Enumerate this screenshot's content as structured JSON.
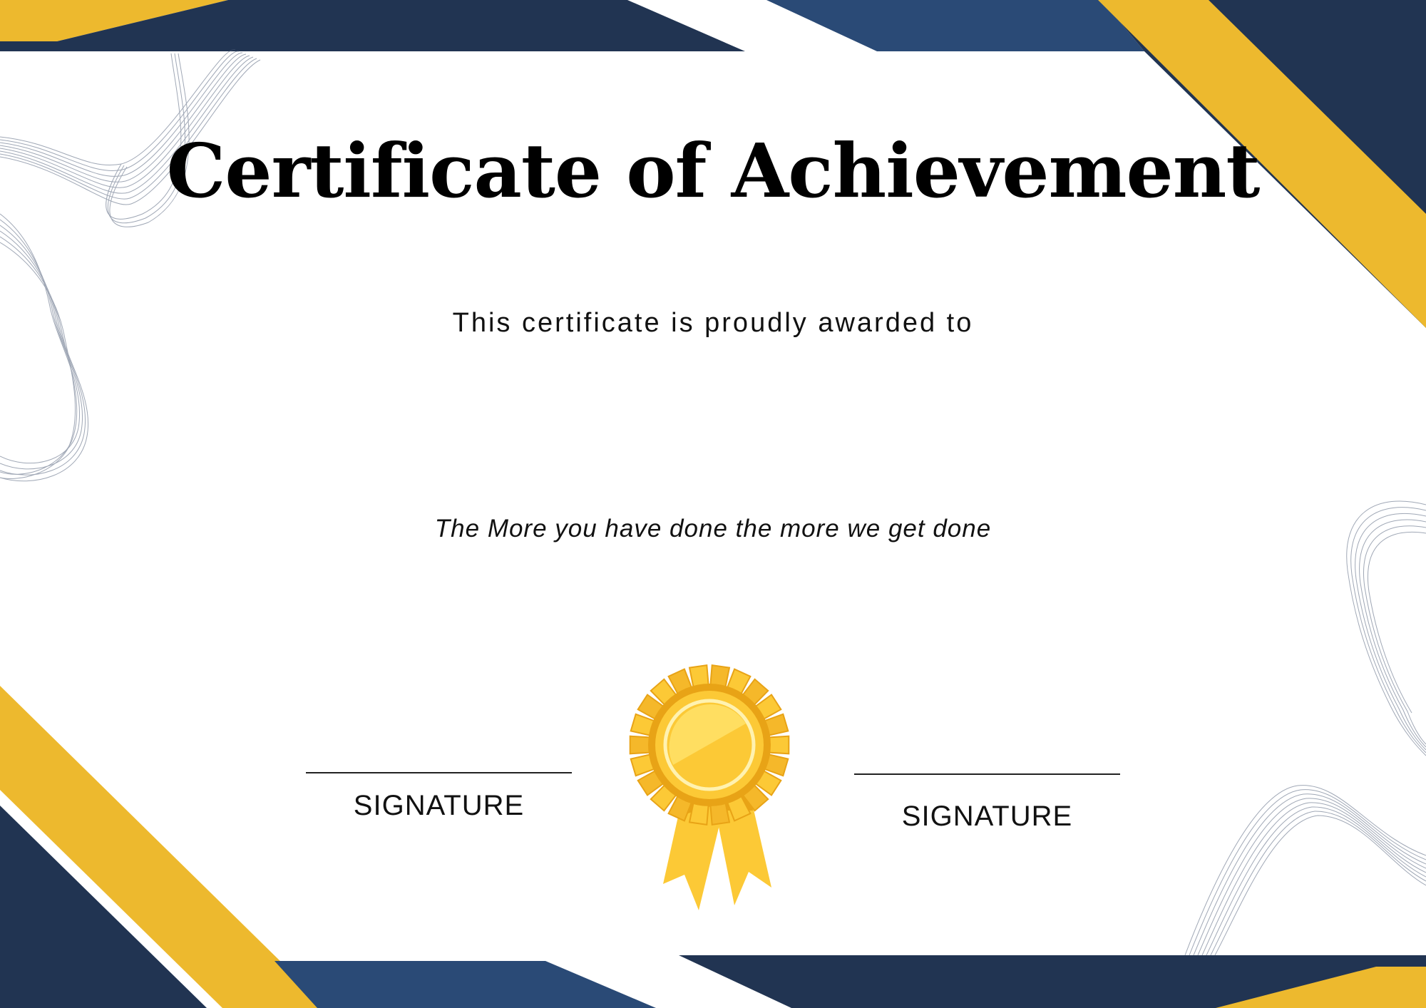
{
  "certificate": {
    "title": "Certificate of Achievement",
    "subtitle": "This certificate is proudly awarded to",
    "tagline": "The More you have done the more we get done",
    "signatures": {
      "left_label": "SIGNATURE",
      "right_label": "SIGNATURE"
    },
    "seal": {
      "icon": "award-rosette-icon"
    }
  },
  "colors": {
    "navy": "#213452",
    "blue": "#2a4a76",
    "gold": "#edb92e",
    "seal_gold": "#fcc936",
    "seal_dark": "#e8a316",
    "text": "#000000"
  }
}
